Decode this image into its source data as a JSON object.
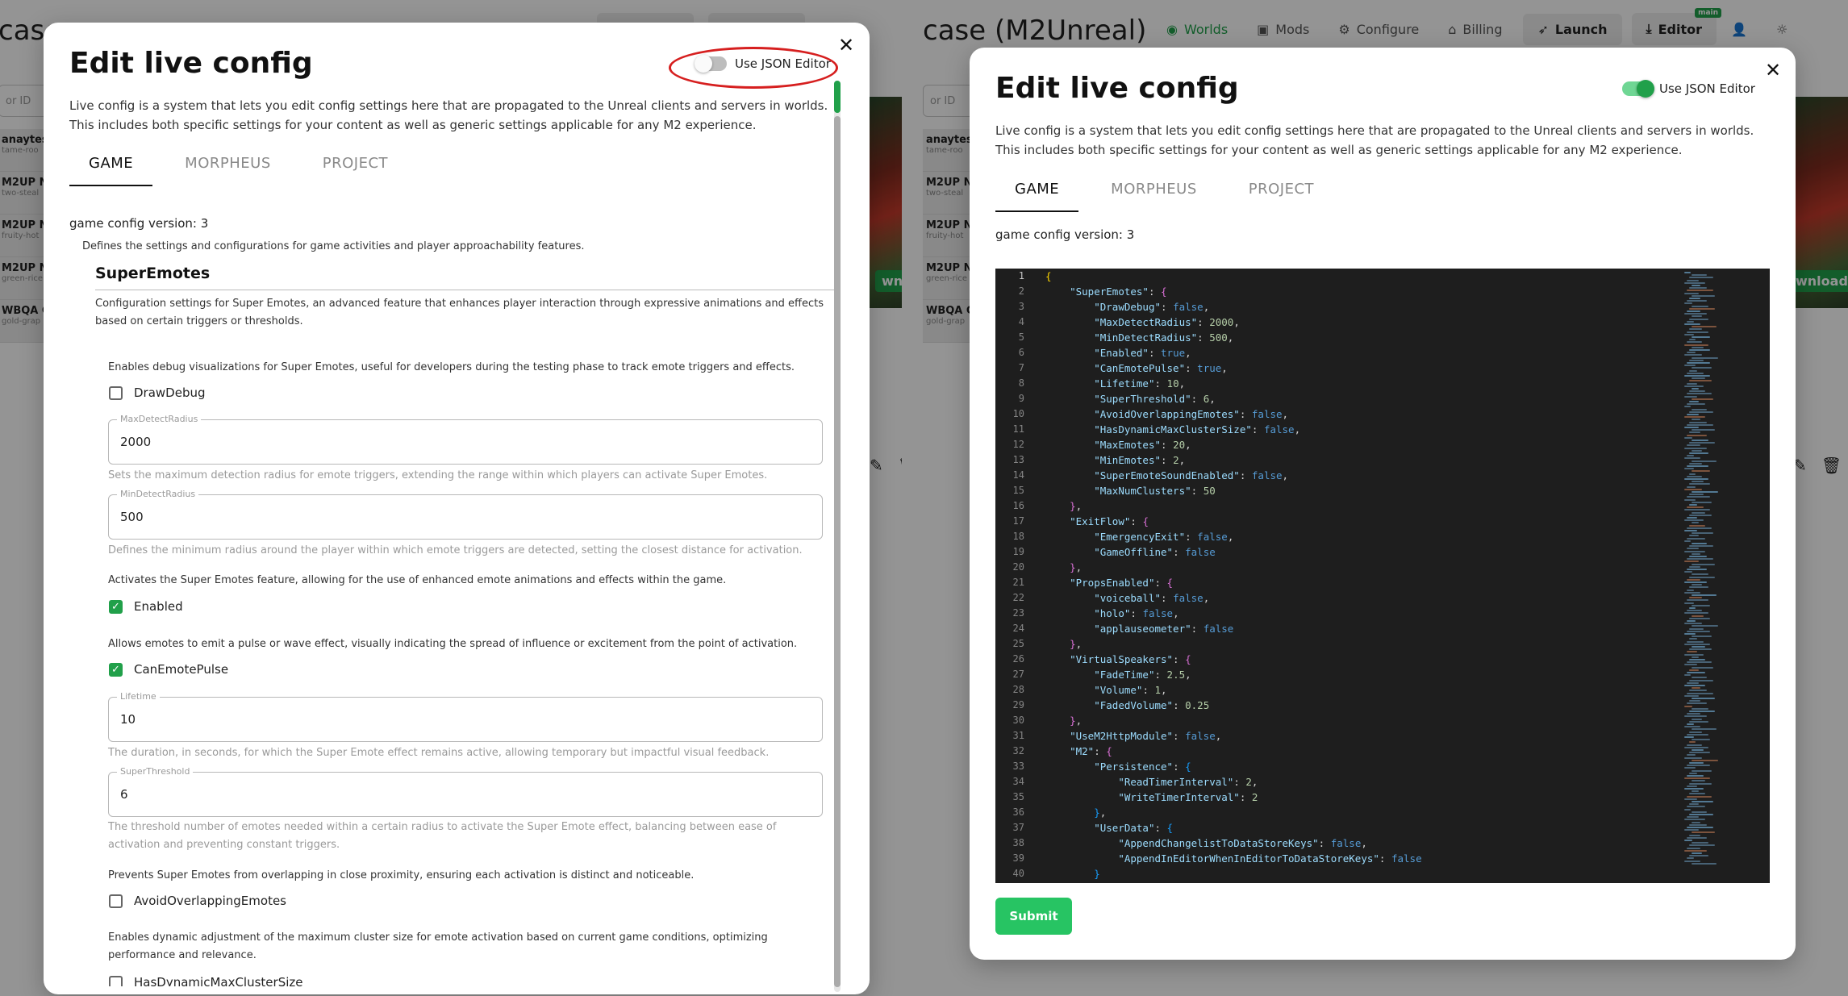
{
  "background": {
    "left_title": "case",
    "right_title": "case (M2Unreal)",
    "nav": [
      {
        "label": "Worlds",
        "icon": "globe-icon"
      },
      {
        "label": "Mods",
        "icon": "image-icon"
      },
      {
        "label": "Configure",
        "icon": "gear-icon"
      },
      {
        "label": "Billing",
        "icon": "bank-icon"
      }
    ],
    "launch_label": "Launch",
    "editor_label": "Editor",
    "main_badge": "main",
    "search_placeholder": "or ID",
    "list_items": [
      {
        "title": "anaytes",
        "sub": "tame-roo"
      },
      {
        "title": "M2UP N",
        "sub": "two-steal"
      },
      {
        "title": "M2UP N",
        "sub": "fruity-hot"
      },
      {
        "title": "M2UP N",
        "sub": "green-rice"
      },
      {
        "title": "WBQA C",
        "sub": "gold-grap"
      }
    ],
    "download_label": "wnload"
  },
  "left_modal": {
    "title": "Edit live config",
    "toggle_label": "Use JSON Editor",
    "toggle_state": "off",
    "description_line1": "Live config is a system that lets you edit config settings here that are propagated to the Unreal clients and servers in worlds.",
    "description_line2": "This includes both specific settings for your content as well as generic settings applicable for any M2 experience.",
    "tabs": [
      "GAME",
      "MORPHEUS",
      "PROJECT"
    ],
    "version_text": "game config version: 3",
    "game_desc": "Defines the settings and configurations for game activities and player approachability features.",
    "section_title": "SuperEmotes",
    "section_desc_line1": "Configuration settings for Super Emotes, an advanced feature that enhances player interaction through expressive animations and effects",
    "section_desc_line2": "based on certain triggers or thresholds.",
    "draw_debug_desc": "Enables debug visualizations for Super Emotes, useful for developers during the testing phase to track emote triggers and effects.",
    "draw_debug_label": "DrawDebug",
    "max_detect_label": "MaxDetectRadius",
    "max_detect_value": "2000",
    "max_detect_help": "Sets the maximum detection radius for emote triggers, extending the range within which players can activate Super Emotes.",
    "min_detect_label": "MinDetectRadius",
    "min_detect_value": "500",
    "min_detect_help": "Defines the minimum radius around the player within which emote triggers are detected, setting the closest distance for activation.",
    "enabled_desc": "Activates the Super Emotes feature, allowing for the use of enhanced emote animations and effects within the game.",
    "enabled_label": "Enabled",
    "pulse_desc": "Allows emotes to emit a pulse or wave effect, visually indicating the spread of influence or excitement from the point of activation.",
    "pulse_label": "CanEmotePulse",
    "lifetime_label": "Lifetime",
    "lifetime_value": "10",
    "lifetime_help": "The duration, in seconds, for which the Super Emote effect remains active, allowing temporary but impactful visual feedback.",
    "threshold_label": "SuperThreshold",
    "threshold_value": "6",
    "threshold_help_line1": "The threshold number of emotes needed within a certain radius to activate the Super Emote effect, balancing between ease of",
    "threshold_help_line2": "activation and preventing constant triggers.",
    "avoid_desc": "Prevents Super Emotes from overlapping in close proximity, ensuring each activation is distinct and noticeable.",
    "avoid_label": "AvoidOverlappingEmotes",
    "dynamic_desc_line1": "Enables dynamic adjustment of the maximum cluster size for emote activation based on current game conditions, optimizing",
    "dynamic_desc_line2": "performance and relevance.",
    "dynamic_label": "HasDynamicMaxClusterSize"
  },
  "right_modal": {
    "title": "Edit live config",
    "toggle_label": "Use JSON Editor",
    "toggle_state": "on",
    "description_line1": "Live config is a system that lets you edit config settings here that are propagated to the Unreal clients and servers in worlds.",
    "description_line2": "This includes both specific settings for your content as well as generic settings applicable for any M2 experience.",
    "tabs": [
      "GAME",
      "MORPHEUS",
      "PROJECT"
    ],
    "version_text": "game config version: 3",
    "submit_label": "Submit",
    "json_lines": [
      "{",
      "    \"SuperEmotes\": {",
      "        \"DrawDebug\": false,",
      "        \"MaxDetectRadius\": 2000,",
      "        \"MinDetectRadius\": 500,",
      "        \"Enabled\": true,",
      "        \"CanEmotePulse\": true,",
      "        \"Lifetime\": 10,",
      "        \"SuperThreshold\": 6,",
      "        \"AvoidOverlappingEmotes\": false,",
      "        \"HasDynamicMaxClusterSize\": false,",
      "        \"MaxEmotes\": 20,",
      "        \"MinEmotes\": 2,",
      "        \"SuperEmoteSoundEnabled\": false,",
      "        \"MaxNumClusters\": 50",
      "    },",
      "    \"ExitFlow\": {",
      "        \"EmergencyExit\": false,",
      "        \"GameOffline\": false",
      "    },",
      "    \"PropsEnabled\": {",
      "        \"voiceball\": false,",
      "        \"holo\": false,",
      "        \"applauseometer\": false",
      "    },",
      "    \"VirtualSpeakers\": {",
      "        \"FadeTime\": 2.5,",
      "        \"Volume\": 1,",
      "        \"FadedVolume\": 0.25",
      "    },",
      "    \"UseM2HttpModule\": false,",
      "    \"M2\": {",
      "        \"Persistence\": {",
      "            \"ReadTimerInterval\": 2,",
      "            \"WriteTimerInterval\": 2",
      "        },",
      "        \"UserData\": {",
      "            \"AppendChangelistToDataStoreKeys\": false,",
      "            \"AppendInEditorWhenInEditorToDataStoreKeys\": false",
      "        }"
    ]
  },
  "colors": {
    "accent_green": "#21a04a",
    "submit_green": "#27c463",
    "annotation_red": "#d61f1f",
    "editor_bg": "#1e1e1e"
  }
}
